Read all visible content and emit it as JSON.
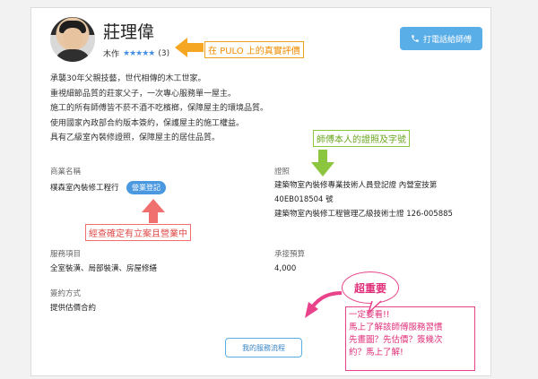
{
  "profile": {
    "name": "莊理偉",
    "category": "木作",
    "stars": "★★★★★",
    "review_count": "(3)",
    "call_button": "打電話給師傅",
    "phone_icon": "phone-icon"
  },
  "description": [
    "承襲30年父親技藝，世代相傳的木工世家。",
    "重視細節品質的莊家父子，一次專心服務單一屋主。",
    "施工的所有師傅皆不菸不酒不吃檳榔，保障屋主的環境品質。",
    "使用國家內政部合約版本簽約，保護屋主的施工權益。",
    "具有乙級室內裝修證照，保障屋主的居住品質。"
  ],
  "details": {
    "business_label": "商業名稱",
    "business_value": "樸森室內裝修工程行",
    "business_badge": "營業登記",
    "license_label": "證照",
    "license_line1": "建築物室內裝修專業技術人員登記證 內營室技第",
    "license_line2": "40EB018504 號",
    "license_line3": "建築物室內裝修工程管理乙級技術士證 126-005885",
    "service_label": "服務項目",
    "service_value": "全室裝潢、局部裝潢、房屋修繕",
    "budget_label": "承接預算",
    "budget_value": "4,000",
    "contract_label": "簽約方式",
    "contract_value": "提供估價合約"
  },
  "process_button": "我的服務流程",
  "annotations": {
    "orange": "在 PULO 上的真實評價",
    "green": "師傅本人的證照及字號",
    "red": "經查確定有立案且營業中",
    "bubble": "超重要",
    "pink_lines": [
      "一定要看!!",
      "馬上了解該師傅服務習慣",
      "先畫圖？先估價？簽幾次",
      "約？馬上了解!"
    ]
  },
  "colors": {
    "accent_blue": "#5aaee8",
    "orange": "#f0a020",
    "green": "#8cc63f",
    "red": "#f07070",
    "pink": "#e8428a"
  }
}
